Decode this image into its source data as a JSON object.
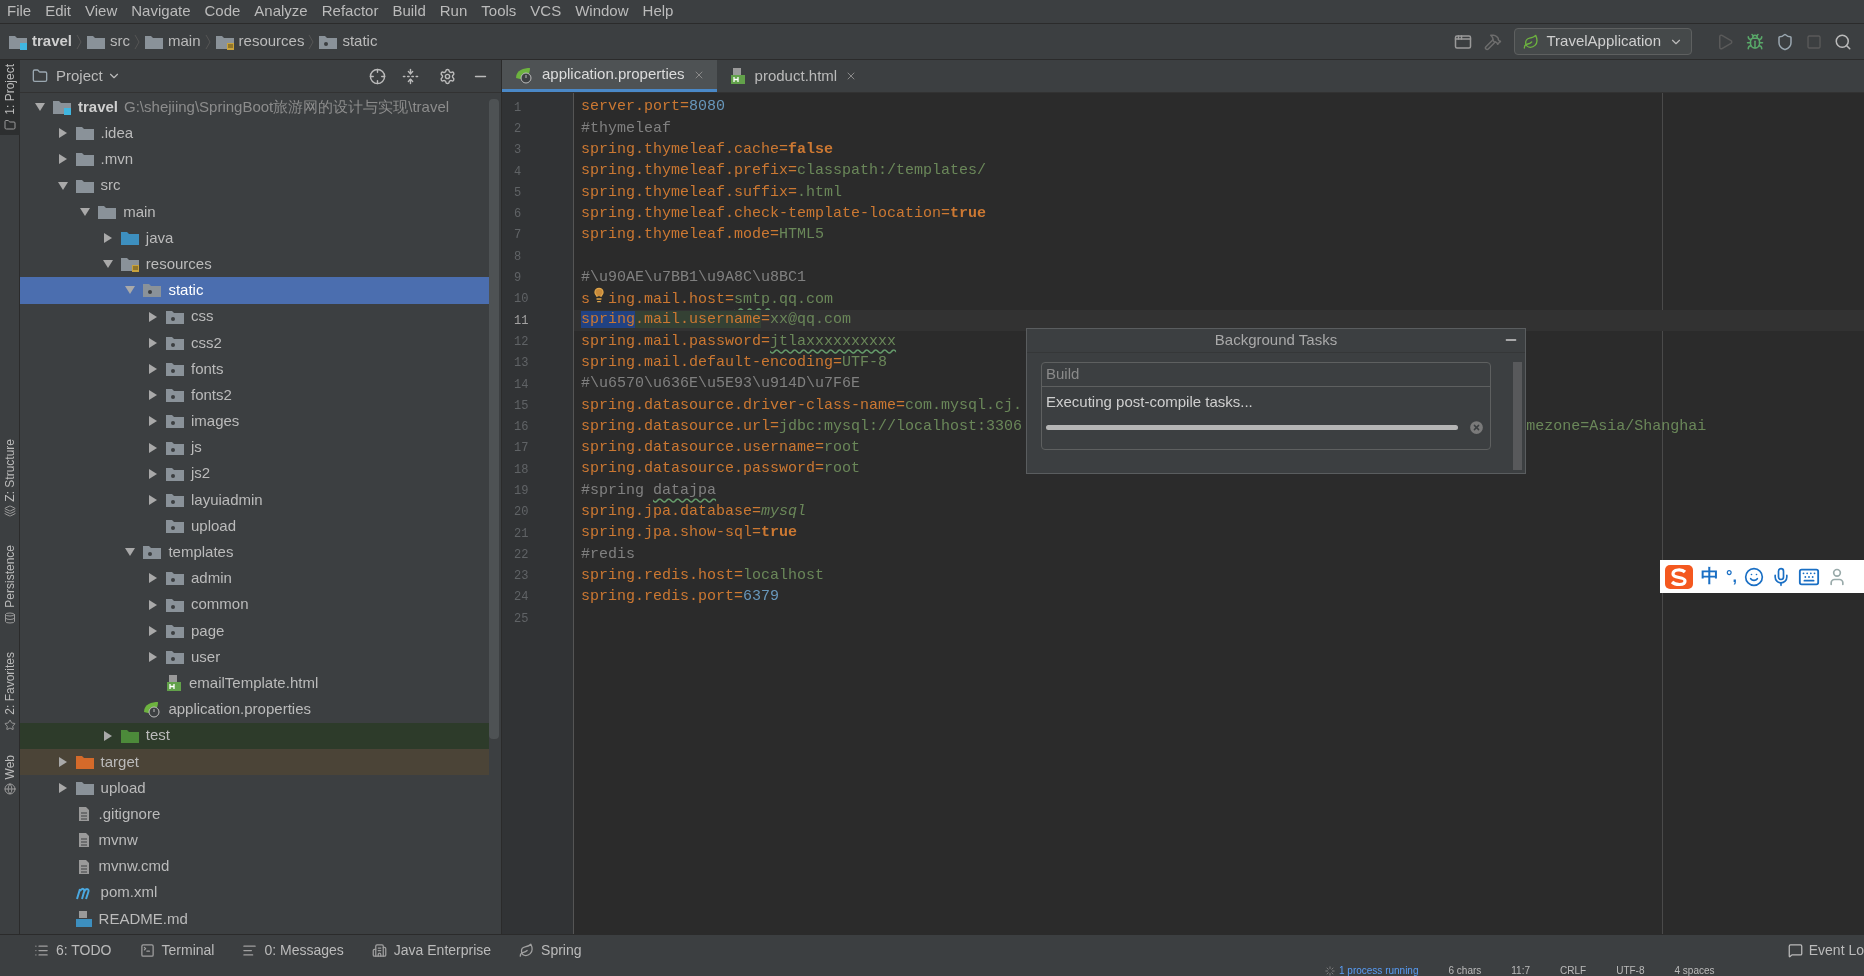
{
  "menu": [
    "File",
    "Edit",
    "View",
    "Navigate",
    "Code",
    "Analyze",
    "Refactor",
    "Build",
    "Run",
    "Tools",
    "VCS",
    "Window",
    "Help"
  ],
  "breadcrumb": [
    {
      "label": "travel",
      "kind": "module"
    },
    {
      "label": "src",
      "kind": "folder"
    },
    {
      "label": "main",
      "kind": "folder"
    },
    {
      "label": "resources",
      "kind": "resources"
    },
    {
      "label": "static",
      "kind": "static"
    }
  ],
  "run_config": {
    "label": "TravelApplication"
  },
  "side_tools": [
    {
      "label": "1: Project",
      "selected": true
    },
    {
      "label": "Z: Structure",
      "selected": false
    },
    {
      "label": "Persistence",
      "selected": false
    },
    {
      "label": "2: Favorites",
      "selected": false
    },
    {
      "label": "Web",
      "selected": false
    }
  ],
  "project_panel": {
    "title": "Project",
    "tree": [
      {
        "name": "travel",
        "kind": "module",
        "path": "G:\\shejiing\\SpringBoot旅游网的设计与实现\\travel",
        "expanded": true,
        "selected": false,
        "children": [
          {
            "name": ".idea",
            "kind": "folder",
            "expanded": false,
            "selected": false
          },
          {
            "name": ".mvn",
            "kind": "folder",
            "expanded": false,
            "selected": false
          },
          {
            "name": "src",
            "kind": "folder",
            "expanded": true,
            "selected": false,
            "children": [
              {
                "name": "main",
                "kind": "folder",
                "expanded": true,
                "selected": false,
                "children": [
                  {
                    "name": "java",
                    "kind": "source",
                    "expanded": false,
                    "selected": false
                  },
                  {
                    "name": "resources",
                    "kind": "resources",
                    "expanded": true,
                    "selected": false,
                    "children": [
                      {
                        "name": "static",
                        "kind": "static",
                        "expanded": true,
                        "selected": true,
                        "children": [
                          {
                            "name": "css",
                            "kind": "static",
                            "expanded": false,
                            "selected": false
                          },
                          {
                            "name": "css2",
                            "kind": "static",
                            "expanded": false,
                            "selected": false
                          },
                          {
                            "name": "fonts",
                            "kind": "static",
                            "expanded": false,
                            "selected": false
                          },
                          {
                            "name": "fonts2",
                            "kind": "static",
                            "expanded": false,
                            "selected": false
                          },
                          {
                            "name": "images",
                            "kind": "static",
                            "expanded": false,
                            "selected": false
                          },
                          {
                            "name": "js",
                            "kind": "static",
                            "expanded": false,
                            "selected": false
                          },
                          {
                            "name": "js2",
                            "kind": "static",
                            "expanded": false,
                            "selected": false
                          },
                          {
                            "name": "layuiadmin",
                            "kind": "static",
                            "expanded": false,
                            "selected": false
                          },
                          {
                            "name": "upload",
                            "kind": "static",
                            "selected": false
                          }
                        ]
                      },
                      {
                        "name": "templates",
                        "kind": "static",
                        "expanded": true,
                        "selected": false,
                        "children": [
                          {
                            "name": "admin",
                            "kind": "static",
                            "expanded": false,
                            "selected": false
                          },
                          {
                            "name": "common",
                            "kind": "static",
                            "expanded": false,
                            "selected": false
                          },
                          {
                            "name": "page",
                            "kind": "static",
                            "expanded": false,
                            "selected": false
                          },
                          {
                            "name": "user",
                            "kind": "static",
                            "expanded": false,
                            "selected": false
                          },
                          {
                            "name": "emailTemplate.html",
                            "kind": "html",
                            "selected": false
                          }
                        ]
                      },
                      {
                        "name": "application.properties",
                        "kind": "properties",
                        "selected": false
                      }
                    ]
                  },
                  {
                    "name": "test",
                    "kind": "test",
                    "expanded": false,
                    "selected": false
                  }
                ]
              }
            ]
          },
          {
            "name": "target",
            "kind": "excluded",
            "expanded": false,
            "selected": false
          },
          {
            "name": "upload",
            "kind": "folder",
            "expanded": false,
            "selected": false
          },
          {
            "name": ".gitignore",
            "kind": "file",
            "selected": false
          },
          {
            "name": "mvnw",
            "kind": "file",
            "selected": false
          },
          {
            "name": "mvnw.cmd",
            "kind": "file",
            "selected": false
          },
          {
            "name": "pom.xml",
            "kind": "maven",
            "selected": false
          },
          {
            "name": "README.md",
            "kind": "markdown",
            "selected": false
          }
        ]
      }
    ]
  },
  "editor_tabs": [
    {
      "label": "application.properties",
      "kind": "properties",
      "selected": true
    },
    {
      "label": "product.html",
      "kind": "html",
      "selected": false
    }
  ],
  "code_lines": [
    {
      "number": "1",
      "current": false,
      "segments": [
        {
          "text": "server.port=",
          "kind": "key"
        },
        {
          "text": "8080",
          "kind": "number"
        }
      ]
    },
    {
      "number": "2",
      "current": false,
      "segments": [
        {
          "text": "#thymeleaf",
          "kind": "comment"
        }
      ]
    },
    {
      "number": "3",
      "current": false,
      "segments": [
        {
          "text": "spring.thymeleaf.cache=",
          "kind": "key"
        },
        {
          "text": "false",
          "kind": "keyword"
        }
      ]
    },
    {
      "number": "4",
      "current": false,
      "segments": [
        {
          "text": "spring.thymeleaf.prefix=",
          "kind": "key"
        },
        {
          "text": "classpath:/templates/",
          "kind": "value"
        }
      ]
    },
    {
      "number": "5",
      "current": false,
      "segments": [
        {
          "text": "spring.thymeleaf.suffix=",
          "kind": "key"
        },
        {
          "text": ".html",
          "kind": "value"
        }
      ]
    },
    {
      "number": "6",
      "current": false,
      "segments": [
        {
          "text": "spring.thymeleaf.check-template-location=",
          "kind": "key"
        },
        {
          "text": "true",
          "kind": "keyword"
        }
      ]
    },
    {
      "number": "7",
      "current": false,
      "segments": [
        {
          "text": "spring.thymeleaf.mode=",
          "kind": "key"
        },
        {
          "text": "HTML5",
          "kind": "value"
        }
      ]
    },
    {
      "number": "8",
      "current": false
    },
    {
      "number": "9",
      "current": false,
      "segments": [
        {
          "text": "#\\u90AE\\u7BB1\\u9A8C\\u8BC1",
          "kind": "comment"
        }
      ]
    },
    {
      "number": "10",
      "current": false,
      "segments": [
        {
          "text": "s",
          "kind": "key"
        },
        {
          "text": "ing.mail.host=",
          "kind": "key",
          "bulb_before": true
        },
        {
          "text": "smtp",
          "kind": "value",
          "typo": true
        },
        {
          "text": ".qq.com",
          "kind": "value"
        }
      ]
    },
    {
      "number": "11",
      "current": true,
      "segments": [
        {
          "text": "spring",
          "kind": "key",
          "in_selection": true
        },
        {
          "text": ".mail.username",
          "kind": "key",
          "usage": true
        },
        {
          "text": "=",
          "kind": "key"
        },
        {
          "text": "xx@qq.com",
          "kind": "value"
        }
      ]
    },
    {
      "number": "12",
      "current": false,
      "segments": [
        {
          "text": "spring.mail.password=",
          "kind": "key"
        },
        {
          "text": "jtlaxxxxxxxxxx",
          "kind": "value",
          "typo": true
        }
      ]
    },
    {
      "number": "13",
      "current": false,
      "segments": [
        {
          "text": "spring.mail.default-encoding=",
          "kind": "key"
        },
        {
          "text": "UTF-8",
          "kind": "value"
        }
      ]
    },
    {
      "number": "14",
      "current": false,
      "segments": [
        {
          "text": "#\\u6570\\u636E\\u5E93\\u914D\\u7F6E",
          "kind": "comment"
        }
      ]
    },
    {
      "number": "15",
      "current": false,
      "segments": [
        {
          "text": "spring.datasource.driver-class-name=",
          "kind": "key"
        },
        {
          "text": "com.mysql.cj.",
          "kind": "value"
        }
      ]
    },
    {
      "number": "16",
      "current": false,
      "segments": [
        {
          "text": "spring.datasource.url=",
          "kind": "key"
        },
        {
          "text": "jdbc:mysql://localhost:3306",
          "kind": "value"
        }
      ],
      "tail": "mezone=Asia/Shanghai"
    },
    {
      "number": "17",
      "current": false,
      "segments": [
        {
          "text": "spring.datasource.username=",
          "kind": "key"
        },
        {
          "text": "root",
          "kind": "value"
        }
      ]
    },
    {
      "number": "18",
      "current": false,
      "segments": [
        {
          "text": "spring.datasource.password=",
          "kind": "key"
        },
        {
          "text": "root",
          "kind": "value"
        }
      ]
    },
    {
      "number": "19",
      "current": false,
      "segments": [
        {
          "text": "#spring ",
          "kind": "comment"
        },
        {
          "text": "datajpa",
          "kind": "comment",
          "typo": true
        }
      ]
    },
    {
      "number": "20",
      "current": false,
      "segments": [
        {
          "text": "spring.jpa.database=",
          "kind": "key"
        },
        {
          "text": "mysql",
          "kind": "enum"
        }
      ]
    },
    {
      "number": "21",
      "current": false,
      "segments": [
        {
          "text": "spring.jpa.show-sql=",
          "kind": "key"
        },
        {
          "text": "true",
          "kind": "keyword"
        }
      ]
    },
    {
      "number": "22",
      "current": false,
      "segments": [
        {
          "text": "#redis",
          "kind": "comment"
        }
      ]
    },
    {
      "number": "23",
      "current": false,
      "segments": [
        {
          "text": "spring.redis.host=",
          "kind": "key"
        },
        {
          "text": "localhost",
          "kind": "value"
        }
      ]
    },
    {
      "number": "24",
      "current": false,
      "segments": [
        {
          "text": "spring.redis.port=",
          "kind": "key"
        },
        {
          "text": "6379",
          "kind": "number"
        }
      ]
    },
    {
      "number": "25",
      "current": false
    }
  ],
  "background_tasks": {
    "title": "Background Tasks",
    "group": "Build",
    "task": "Executing post-compile tasks...",
    "level": 1
  },
  "ime_toolbar": {
    "mode": "中",
    "punctuation": "°,"
  },
  "bottom_tools": [
    {
      "label": "6: TODO",
      "kind": "todo"
    },
    {
      "label": "Terminal",
      "kind": "terminal"
    },
    {
      "label": "0: Messages",
      "kind": "messages"
    },
    {
      "label": "Java Enterprise",
      "kind": "enterprise"
    },
    {
      "label": "Spring",
      "kind": "spring"
    }
  ],
  "event_log": "Event Lo",
  "status_bar": {
    "process": "1 process running",
    "items": [
      "6 chars",
      "11:7",
      "CRLF",
      "UTF-8",
      "4 spaces"
    ]
  }
}
